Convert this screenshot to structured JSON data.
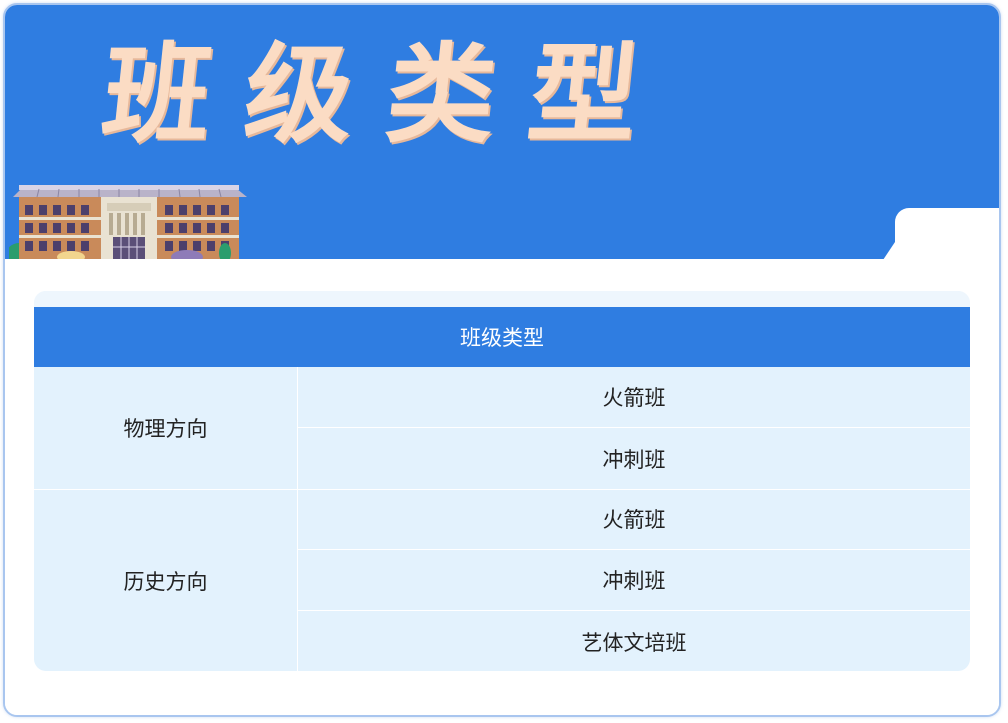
{
  "banner": {
    "title": "班级类型",
    "background_color": "#2f7de1",
    "title_color": "#fbdcc4",
    "illustration": "school-building-illustration"
  },
  "table": {
    "header": "班级类型",
    "header_color": "#2f7de1",
    "body_color": "#e3f2fd",
    "groups": [
      {
        "label": "物理方向",
        "items": [
          "火箭班",
          "冲刺班"
        ]
      },
      {
        "label": "历史方向",
        "items": [
          "火箭班",
          "冲刺班",
          "艺体文培班"
        ]
      }
    ]
  }
}
